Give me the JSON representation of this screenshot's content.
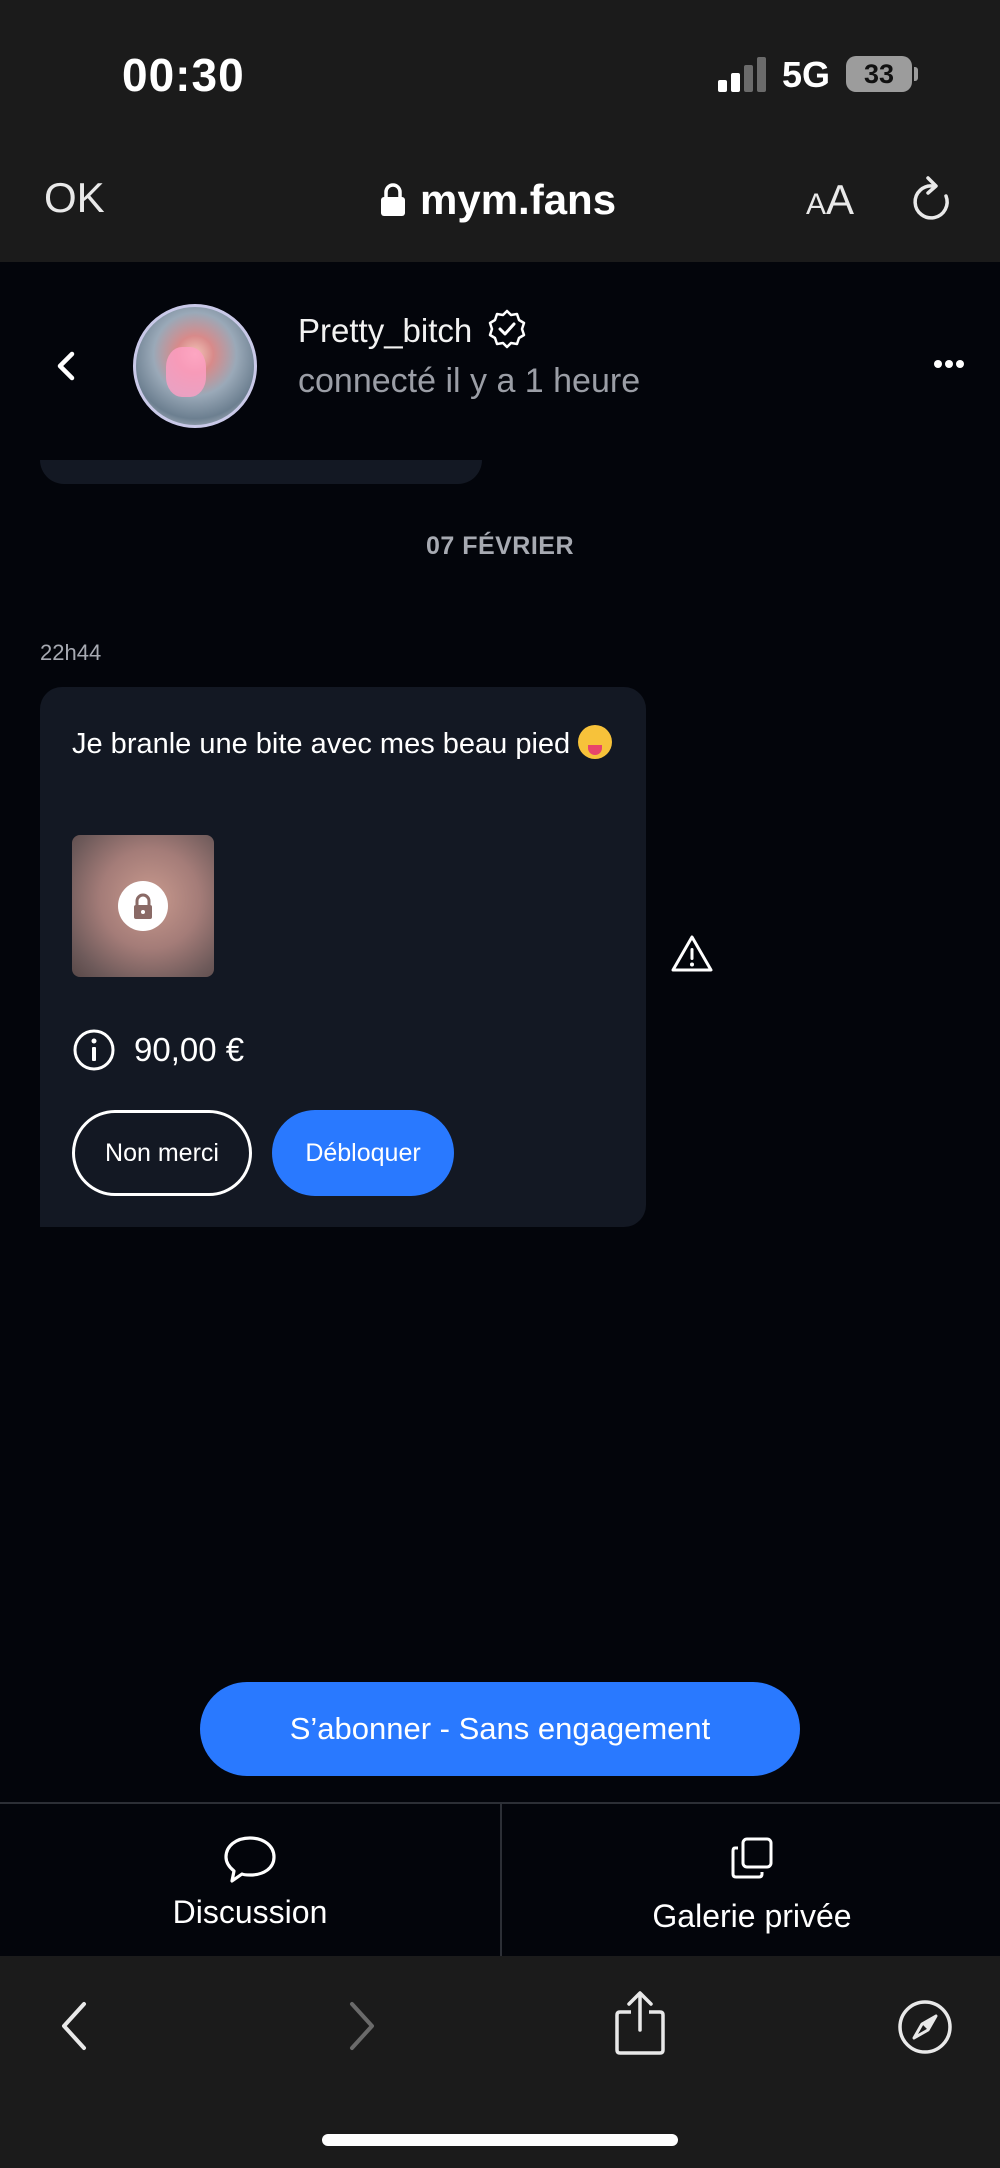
{
  "status_bar": {
    "time": "00:30",
    "network": "5G",
    "battery": "33"
  },
  "browser": {
    "done_label": "OK",
    "url": "mym.fans",
    "text_size_label": "A",
    "text_size_label_large": "A"
  },
  "chat_header": {
    "username": "Pretty_bitch",
    "last_seen": "connecté il y a 1 heure"
  },
  "chat": {
    "date_separator": "07 FÉVRIER",
    "message": {
      "time": "22h44",
      "text": "Je branle une bite avec mes beau pied",
      "emoji": "squinting-face-with-tongue",
      "price": "90,00 €",
      "decline_label": "Non merci",
      "unlock_label": "Débloquer"
    }
  },
  "subscribe_label": "S’abonner - Sans engagement",
  "tabs": [
    {
      "label": "Discussion",
      "icon": "chat-bubble-icon"
    },
    {
      "label": "Galerie privée",
      "icon": "gallery-icon"
    }
  ],
  "colors": {
    "accent": "#2979ff",
    "background": "#03050b",
    "bubble": "#131823",
    "browser_chrome": "#1b1b1b"
  }
}
